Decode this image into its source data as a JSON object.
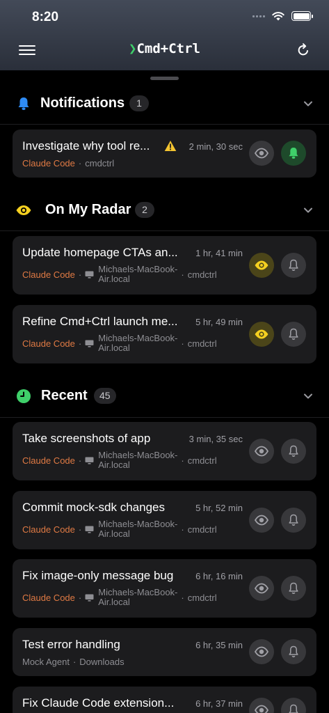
{
  "status_bar": {
    "time": "8:20"
  },
  "header": {
    "logo_chevron": "❯",
    "logo_text": "Cmd+Ctrl"
  },
  "colors": {
    "accent_green": "#3fd06a",
    "agent_orange": "#e07a44",
    "radar_yellow": "#f5d020",
    "bell_blue": "#2e8bf5"
  },
  "sections": {
    "notifications": {
      "title": "Notifications",
      "count": "1"
    },
    "radar": {
      "title": "On My Radar",
      "count": "2"
    },
    "recent": {
      "title": "Recent",
      "count": "45"
    }
  },
  "cards": [
    {
      "title": "Investigate why tool re...",
      "time": "2 min, 30 sec",
      "agent": "Claude Code",
      "host": "",
      "project": "cmdctrl",
      "icons": [
        "warning-icon",
        "eye-icon",
        "bell-icon"
      ]
    },
    {
      "title": "Update homepage CTAs an...",
      "time": "1 hr, 41 min",
      "agent": "Claude Code",
      "host": "Michaels-MacBook-Air.local",
      "project": "cmdctrl"
    },
    {
      "title": "Refine Cmd+Ctrl launch me...",
      "time": "5 hr, 49 min",
      "agent": "Claude Code",
      "host": "Michaels-MacBook-Air.local",
      "project": "cmdctrl"
    },
    {
      "title": "Take screenshots of app",
      "time": "3 min, 35 sec",
      "agent": "Claude Code",
      "host": "Michaels-MacBook-Air.local",
      "project": "cmdctrl"
    },
    {
      "title": "Commit mock-sdk changes",
      "time": "5 hr, 52 min",
      "agent": "Claude Code",
      "host": "Michaels-MacBook-Air.local",
      "project": "cmdctrl"
    },
    {
      "title": "Fix image-only message bug",
      "time": "6 hr, 16 min",
      "agent": "Claude Code",
      "host": "Michaels-MacBook-Air.local",
      "project": "cmdctrl"
    },
    {
      "title": "Test error handling",
      "time": "6 hr, 35 min",
      "agent": "Mock Agent",
      "host": "",
      "project": "Downloads"
    },
    {
      "title": "Fix Claude Code extension...",
      "time": "6 hr, 37 min",
      "agent": "",
      "host": "",
      "project": ""
    }
  ],
  "host_lines": {
    "line1": "Michaels-MacBook-",
    "line2": "Air.local"
  }
}
